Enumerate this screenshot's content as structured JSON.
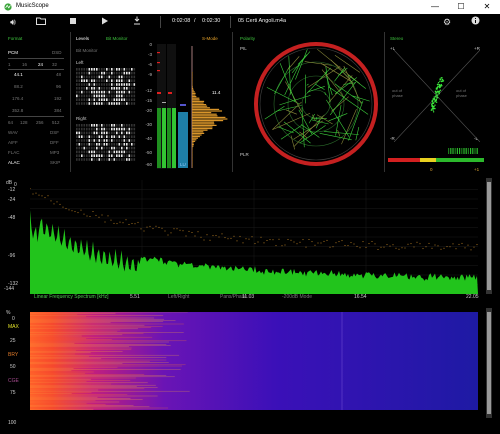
{
  "window": {
    "title": "MusicScope",
    "minimize": "—",
    "maximize": "☐",
    "close": "✕"
  },
  "toolbar": {
    "position": "0:02:08",
    "divider": "/",
    "duration": "0:02:30",
    "track": "05 Certi Angoli.m4a"
  },
  "format": {
    "title": "Format",
    "pcm": "PCM",
    "dsd": "DSD",
    "bits": [
      "1",
      "16",
      "24",
      "32"
    ],
    "rates_left": [
      "44.1",
      "88.2",
      "176.4",
      "352.8"
    ],
    "rates_right": [
      "48",
      "96",
      "192",
      "384"
    ],
    "dsd_rates": [
      "64",
      "128",
      "256",
      "512"
    ],
    "codecs_left": [
      "WAV",
      "AIFF",
      "FLAC",
      "ALAC"
    ],
    "codecs_right": [
      "DSF",
      "DFF",
      "MP3",
      "SKIP"
    ],
    "active": [
      "PCM",
      "24",
      "44.1",
      "ALAC"
    ]
  },
  "levels": {
    "title": "Levels",
    "bit_monitor_tab": "Bit Monitor",
    "bit_monitor_label": "Bit Monitor",
    "left": "Left",
    "right": "Right",
    "meter_mode": "S-Mode",
    "scale": [
      "0",
      "-3",
      "-6",
      "-9",
      "-12",
      "-15",
      "-20",
      "-30",
      "-40",
      "-50",
      "-60"
    ],
    "peak_value": "11.4",
    "lu_label": "LU"
  },
  "polarity": {
    "title": "Polarity",
    "pil": "PIL",
    "plr": "PLR"
  },
  "stereo": {
    "title": "Stereo",
    "plus_l": "+L",
    "plus_r": "+R",
    "minus_l": "-L",
    "minus_r": "-R",
    "out_of_phase": "out of phase",
    "scale_min": "-1",
    "scale_mid": "0",
    "scale_max": "+1"
  },
  "spectrum": {
    "db_label": "dB",
    "ticks": [
      "0",
      "-12",
      "-24",
      "-36",
      "-48",
      "-60",
      "-72",
      "-84",
      "-96",
      "-108",
      "-120",
      "-132",
      "-144"
    ],
    "mode_label": "Linear Frequency Spectrum [kHz]",
    "lr_label": "Left/Right",
    "pans_label": "Pans/Phase",
    "mode2_label": "-200dB Mode",
    "x_ticks": [
      "5.51",
      "11.03",
      "16.54",
      "22.05"
    ],
    "colors": {
      "fill": "#22c41c",
      "peak": "#d9952a"
    }
  },
  "spectrogram": {
    "percent": "%",
    "ticks": [
      "0",
      "25",
      "50",
      "75",
      "100"
    ],
    "labels": [
      "MAX",
      "BRY",
      "CGE"
    ]
  }
}
